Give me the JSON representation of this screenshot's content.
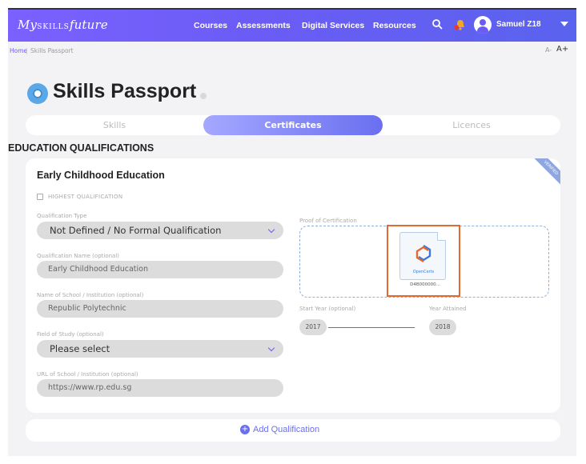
{
  "header": {
    "logo_prefix": "My",
    "logo_middle": "SKILLS",
    "logo_suffix": "future",
    "nav": [
      "Courses",
      "Assessments",
      "Digital Services",
      "Resources"
    ],
    "username": "Samuel Z18"
  },
  "breadcrumb": {
    "home": "Home",
    "separator": "|",
    "current": "Skills Passport",
    "font_small": "A-",
    "font_large": "A+"
  },
  "page": {
    "title": "Skills Passport"
  },
  "tabs": [
    {
      "label": "Skills",
      "active": false
    },
    {
      "label": "Certificates",
      "active": true
    },
    {
      "label": "Licences",
      "active": false
    }
  ],
  "section": {
    "title": "EDUCATION QUALIFICATIONS"
  },
  "card": {
    "ribbon": "VERIFIED",
    "title": "Early Childhood Education",
    "highest_qualification_label": "HIGHEST QUALIFICATION",
    "qualification_type": {
      "label": "Qualification Type",
      "value": "Not Defined / No Formal Qualification"
    },
    "qualification_name": {
      "label": "Qualification Name (optional)",
      "value": "Early Childhood Education"
    },
    "school_name": {
      "label": "Name of School / Institution (optional)",
      "value": "Republic Polytechnic"
    },
    "field_of_study": {
      "label": "Field of Study (optional)",
      "value": "Please select"
    },
    "school_url": {
      "label": "URL of School / Institution (optional)",
      "value": "https://www.rp.edu.sg"
    },
    "proof": {
      "label": "Proof of Certification",
      "brand": "OpenCerts",
      "file_name": "D4B000000..."
    },
    "start_year": {
      "label": "Start Year (optional)",
      "value": "2017"
    },
    "year_attained": {
      "label": "Year Attained",
      "value": "2018"
    }
  },
  "add_qualification": {
    "label": "Add Qualification"
  },
  "colors": {
    "primary": "#6a5cf5",
    "accent": "#e06b32",
    "bell": "#f5a623"
  }
}
